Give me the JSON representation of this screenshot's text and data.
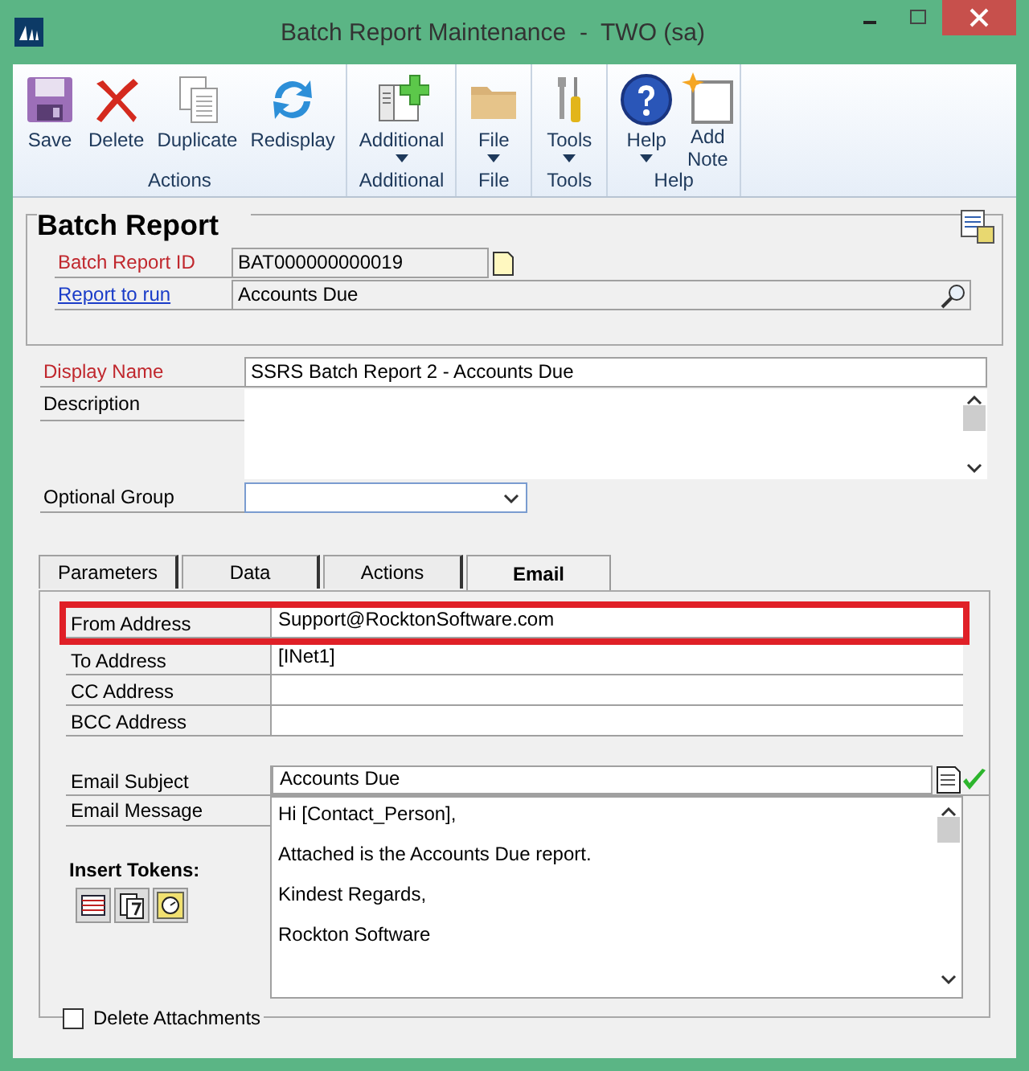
{
  "window": {
    "title": "Batch Report Maintenance  -  TWO (sa)"
  },
  "ribbon": {
    "groups": [
      {
        "label": "Actions",
        "buttons": [
          {
            "label": "Save",
            "dropdown": false
          },
          {
            "label": "Delete",
            "dropdown": false
          },
          {
            "label": "Duplicate",
            "dropdown": false
          },
          {
            "label": "Redisplay",
            "dropdown": false
          }
        ]
      },
      {
        "label": "Additional",
        "buttons": [
          {
            "label": "Additional",
            "dropdown": true
          }
        ]
      },
      {
        "label": "File",
        "buttons": [
          {
            "label": "File",
            "dropdown": true
          }
        ]
      },
      {
        "label": "Tools",
        "buttons": [
          {
            "label": "Tools",
            "dropdown": true
          }
        ]
      },
      {
        "label": "Help",
        "buttons": [
          {
            "label": "Help",
            "dropdown": true
          },
          {
            "label": "Add Note",
            "dropdown": false
          }
        ]
      }
    ]
  },
  "header": {
    "title": "Batch Report",
    "fields": [
      {
        "label": "Batch Report ID",
        "kind": "required",
        "value": "BAT000000000019"
      },
      {
        "label": "Report to run",
        "kind": "link",
        "value": "Accounts Due"
      }
    ]
  },
  "display_name": {
    "label": "Display Name",
    "kind": "required",
    "value": "SSRS Batch Report 2 - Accounts Due"
  },
  "description": {
    "label": "Description"
  },
  "optional_group": {
    "label": "Optional Group"
  },
  "tabs": [
    {
      "label": "Parameters",
      "selected": false
    },
    {
      "label": "Data",
      "selected": false
    },
    {
      "label": "Actions",
      "selected": false
    },
    {
      "label": "Email",
      "selected": true
    }
  ],
  "email": {
    "addresses": [
      {
        "label": "From Address",
        "value": "Support@RocktonSoftware.com",
        "highlighted": true
      },
      {
        "label": "To Address",
        "value": "[INet1]",
        "highlighted": false
      },
      {
        "label": "CC Address",
        "highlighted": false
      },
      {
        "label": "BCC Address",
        "highlighted": false
      }
    ],
    "subject": {
      "label": "Email Subject",
      "value": "Accounts Due"
    },
    "message": {
      "label": "Email Message",
      "lines": [
        "Hi [Contact_Person],",
        "Attached is the Accounts Due report.",
        "Kindest Regards,",
        "Rockton Software"
      ]
    },
    "insert_tokens": {
      "label": "Insert Tokens:"
    },
    "delete_attachments": {
      "label": "Delete Attachments",
      "checked": false
    }
  }
}
